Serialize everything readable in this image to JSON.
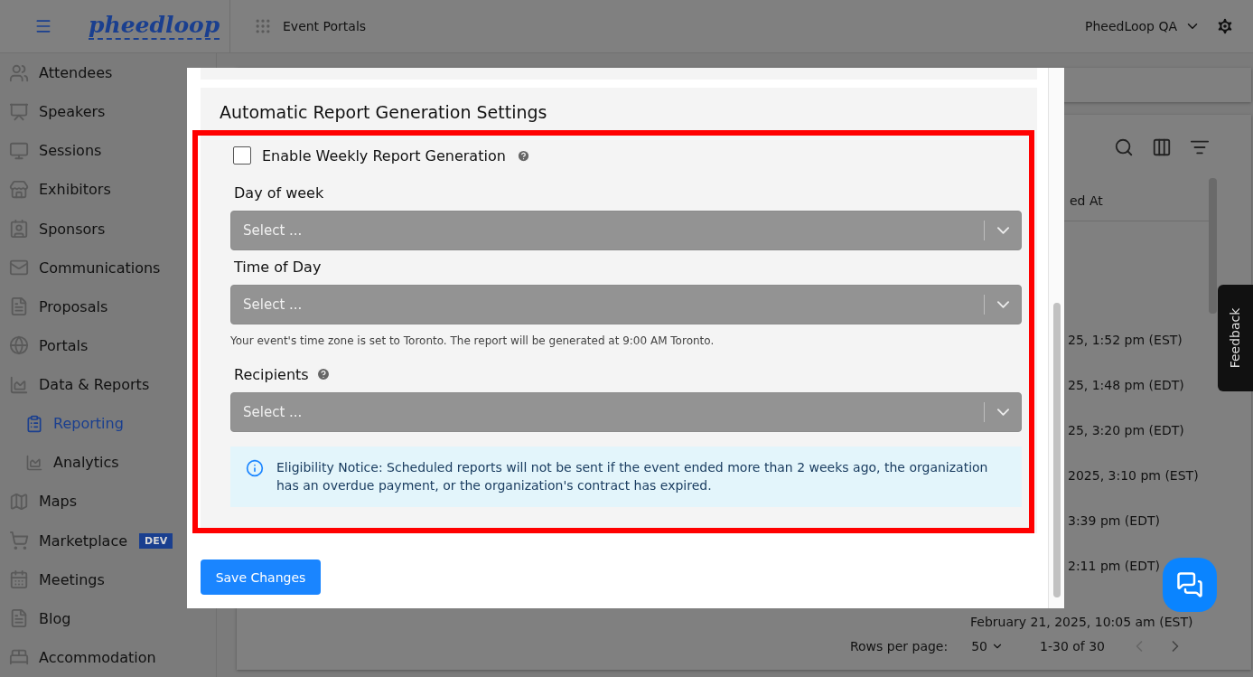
{
  "app_bar": {
    "logo": "pheedloop",
    "section": "Event Portals",
    "organization": "PheedLoop QA"
  },
  "sidebar": {
    "items": [
      {
        "label": "Attendees",
        "selected": false
      },
      {
        "label": "Speakers",
        "selected": false
      },
      {
        "label": "Sessions",
        "selected": false
      },
      {
        "label": "Exhibitors",
        "selected": false
      },
      {
        "label": "Sponsors",
        "selected": false
      },
      {
        "label": "Communications",
        "selected": false
      },
      {
        "label": "Proposals",
        "selected": false
      },
      {
        "label": "Portals",
        "selected": false
      },
      {
        "label": "Data & Reports",
        "selected": false,
        "children": [
          {
            "label": "Reporting",
            "selected": true
          },
          {
            "label": "Analytics",
            "selected": false
          }
        ]
      },
      {
        "label": "Maps",
        "selected": false
      },
      {
        "label": "Marketplace",
        "selected": false,
        "badge": "DEV"
      },
      {
        "label": "Meetings",
        "selected": false
      },
      {
        "label": "Blog",
        "selected": false
      },
      {
        "label": "Accommodation",
        "selected": false
      }
    ]
  },
  "table": {
    "column_header": "ed At",
    "rows": [
      {
        "column_1": "25, 1:52 pm (EST)"
      },
      {
        "column_1": "25, 1:48 pm (EDT)"
      },
      {
        "column_1": "25, 3:20 pm (EDT)"
      },
      {
        "column_1": "2025, 3:10 pm (EST)"
      },
      {
        "column_1": "3:39 pm (EDT)"
      },
      {
        "column_1": "2:11 pm (EDT)"
      },
      {
        "column_1": "February 21, 2025, 10:05 am (EST)"
      }
    ],
    "pagination": {
      "rows_per_page_label": "Rows per page:",
      "rows_per_page": "50",
      "range": "1-30 of 30"
    }
  },
  "feedback_tab": "Feedback",
  "modal": {
    "section_title": "Automatic Report Generation Settings",
    "enable_weekly": {
      "label": "Enable Weekly Report Generation",
      "checked": false
    },
    "fields": [
      {
        "label": "Day of week",
        "placeholder": "Select ...",
        "help": false,
        "disabled": true
      },
      {
        "label": "Time of Day",
        "placeholder": "Select ...",
        "help": false,
        "disabled": true,
        "note": "Your event's time zone is set to Toronto. The report will be generated at 9:00 AM Toronto."
      },
      {
        "label": "Recipients",
        "placeholder": "Select ...",
        "help": true,
        "disabled": true
      }
    ],
    "notice": "Eligibility Notice: Scheduled reports will not be sent if the event ended more than 2 weeks ago, the organization has an overdue payment, or the organization's contract has expired.",
    "save_button": "Save Changes"
  }
}
